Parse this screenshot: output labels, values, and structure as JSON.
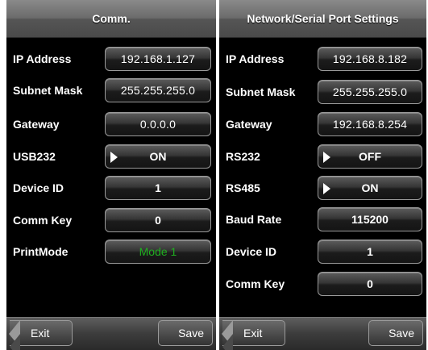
{
  "left_screen": {
    "title": "Comm.",
    "rows": [
      {
        "label": "IP Address",
        "value": "192.168.1.127"
      },
      {
        "label": "Subnet Mask",
        "value": "255.255.255.0"
      },
      {
        "label": "Gateway",
        "value": "0.0.0.0"
      },
      {
        "label": "USB232",
        "value": "ON",
        "icon": "triangle-right-icon"
      },
      {
        "label": "Device ID",
        "value": "1"
      },
      {
        "label": "Comm Key",
        "value": "0"
      },
      {
        "label": "PrintMode",
        "value": "Mode 1",
        "value_color": "#1fae1f"
      }
    ],
    "footer": {
      "exit_label": "Exit",
      "save_label": "Save"
    }
  },
  "right_screen": {
    "title": "Network/Serial Port Settings",
    "rows": [
      {
        "label": "IP Address",
        "value": "192.168.8.182"
      },
      {
        "label": "Subnet Mask",
        "value": "255.255.255.0"
      },
      {
        "label": "Gateway",
        "value": "192.168.8.254"
      },
      {
        "label": "RS232",
        "value": "OFF",
        "icon": "triangle-right-icon"
      },
      {
        "label": "RS485",
        "value": "ON",
        "icon": "triangle-right-icon"
      },
      {
        "label": "Baud Rate",
        "value": "115200"
      },
      {
        "label": "Device ID",
        "value": "1"
      },
      {
        "label": "Comm Key",
        "value": "0"
      }
    ],
    "footer": {
      "exit_label": "Exit",
      "save_label": "Save"
    }
  },
  "colors": {
    "background": "#000000",
    "header_gradient_top": "#8a8a8a",
    "header_gradient_bottom": "#4a4a4a",
    "text": "#ffffff",
    "mode_value": "#1fae1f"
  }
}
